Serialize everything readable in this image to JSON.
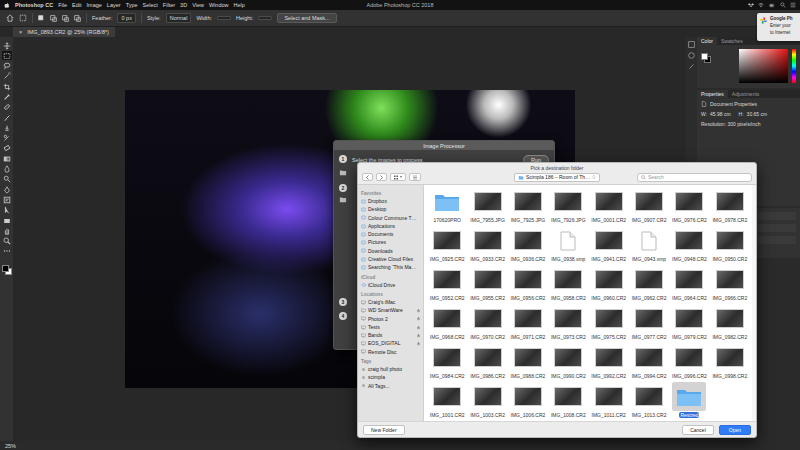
{
  "menu_bar": {
    "items": [
      "Photoshop CC",
      "File",
      "Edit",
      "Image",
      "Layer",
      "Type",
      "Select",
      "Filter",
      "3D",
      "View",
      "Window",
      "Help"
    ],
    "title": "Adobe Photoshop CC 2018"
  },
  "options_bar": {
    "feather_label": "Feather:",
    "feather_value": "0 px",
    "style_label": "Style:",
    "style_value": "Normal",
    "width_label": "Width:",
    "height_label": "Height:",
    "mask_button": "Select and Mask..."
  },
  "document_tab": {
    "label": "IMG_0893.CR2 @ 25% (RGB/8*)",
    "close": "×"
  },
  "tools": [
    {
      "selected": false
    },
    {
      "selected": true
    },
    {
      "selected": false
    },
    {
      "selected": false
    },
    {
      "selected": false
    },
    {
      "selected": false
    },
    {
      "selected": false
    },
    {
      "selected": false
    },
    {
      "selected": false
    },
    {
      "selected": false
    },
    {
      "selected": false
    },
    {
      "selected": false
    },
    {
      "selected": false
    },
    {
      "selected": false
    },
    {
      "selected": false
    },
    {
      "selected": false
    },
    {
      "selected": false
    },
    {
      "selected": false
    },
    {
      "selected": false
    },
    {
      "selected": false
    },
    {
      "selected": false
    }
  ],
  "notification": {
    "lines": [
      "Google Ph",
      "Enter your",
      "to Internet"
    ]
  },
  "color_panel": {
    "tabs": [
      {
        "label": "Color",
        "selected": true
      },
      {
        "label": "Swatches",
        "selected": false
      }
    ]
  },
  "properties_panel": {
    "tabs": [
      {
        "label": "Properties",
        "selected": true
      },
      {
        "label": "Adjustments",
        "selected": false
      }
    ],
    "heading": "Document Properties",
    "fields": [
      {
        "label": "W:",
        "value": "45.98 cm"
      },
      {
        "label": "H:",
        "value": "30.65 cm"
      }
    ],
    "resolution": "Resolution: 300 pixels/inch"
  },
  "status_bar": {
    "zoom": "25%"
  },
  "image_processor": {
    "title": "Image Processor",
    "instruction": "Select the images to process",
    "run": "Run",
    "steps": [
      "1",
      "2",
      "3",
      "4"
    ]
  },
  "file_dialog": {
    "prompt": "Pick a destination folder",
    "path": "Scimpla 186 – Room of Th…",
    "search": {
      "placeholder": "Search"
    },
    "sidebar": [
      {
        "title": "Favorites",
        "items": [
          {
            "label": "Dropbox",
            "ejectable": false
          },
          {
            "label": "Desktop",
            "ejectable": false
          },
          {
            "label": "Colour Commune T…",
            "ejectable": false
          },
          {
            "label": "Applications",
            "ejectable": false
          },
          {
            "label": "Documents",
            "ejectable": false
          },
          {
            "label": "Pictures",
            "ejectable": false
          },
          {
            "label": "Downloads",
            "ejectable": false
          },
          {
            "label": "Creative Cloud Files",
            "ejectable": false
          },
          {
            "label": "Searching “This Ma…",
            "ejectable": false
          }
        ]
      },
      {
        "title": "iCloud",
        "items": [
          {
            "label": "iCloud Drive",
            "ejectable": false
          }
        ]
      },
      {
        "title": "Locations",
        "items": [
          {
            "label": "Craig's iMac",
            "ejectable": false
          },
          {
            "label": "WD SmartWare",
            "ejectable": true
          },
          {
            "label": "Photos 2",
            "ejectable": true
          },
          {
            "label": "Tests",
            "ejectable": true
          },
          {
            "label": "Bands",
            "ejectable": true
          },
          {
            "label": "EOS_DIGITAL",
            "ejectable": true
          },
          {
            "label": "Remote Disc",
            "ejectable": false
          }
        ]
      },
      {
        "title": "Tags",
        "items": [
          {
            "label": "craig hull photo",
            "ejectable": false
          },
          {
            "label": "scimpla",
            "ejectable": false
          },
          {
            "label": "All Tags...",
            "ejectable": false
          }
        ]
      }
    ],
    "files": [
      {
        "name": "170620PRO",
        "kind": "folder",
        "selected": false
      },
      {
        "name": "IMG_7955.JPG",
        "kind": "photo",
        "selected": false
      },
      {
        "name": "IMG_7925.JPG",
        "kind": "photo",
        "selected": false
      },
      {
        "name": "IMG_7926.JPG",
        "kind": "photo",
        "selected": false
      },
      {
        "name": "IMG_0001.CR2",
        "kind": "photo",
        "selected": false
      },
      {
        "name": "IMG_0907.CR2",
        "kind": "photo",
        "selected": false
      },
      {
        "name": "IMG_0976.CR2",
        "kind": "photo",
        "selected": false
      },
      {
        "name": "IMG_0978.CR2",
        "kind": "photo",
        "selected": false
      },
      {
        "name": "IMG_0925.CR2",
        "kind": "photo",
        "selected": false
      },
      {
        "name": "IMG_0933.CR2",
        "kind": "photo",
        "selected": false
      },
      {
        "name": "IMG_0936.CR2",
        "kind": "photo",
        "selected": false
      },
      {
        "name": "IMG_0938.xmp",
        "kind": "document",
        "selected": false
      },
      {
        "name": "IMG_0941.CR2",
        "kind": "photo",
        "selected": false
      },
      {
        "name": "IMG_0943.xmp",
        "kind": "document",
        "selected": false
      },
      {
        "name": "IMG_0948.CR2",
        "kind": "photo",
        "selected": false
      },
      {
        "name": "IMG_0950.CR2",
        "kind": "photo",
        "selected": false
      },
      {
        "name": "IMG_0952.CR2",
        "kind": "photo",
        "selected": false
      },
      {
        "name": "IMG_0955.CR2",
        "kind": "photo",
        "selected": false
      },
      {
        "name": "IMG_0956.CR2",
        "kind": "photo",
        "selected": false
      },
      {
        "name": "IMG_0958.CR2",
        "kind": "photo",
        "selected": false
      },
      {
        "name": "IMG_0960.CR2",
        "kind": "photo",
        "selected": false
      },
      {
        "name": "IMG_0962.CR2",
        "kind": "photo",
        "selected": false
      },
      {
        "name": "IMG_0964.CR2",
        "kind": "photo",
        "selected": false
      },
      {
        "name": "IMG_0966.CR2",
        "kind": "photo",
        "selected": false
      },
      {
        "name": "IMG_0968.CR2",
        "kind": "photo",
        "selected": false
      },
      {
        "name": "IMG_0970.CR2",
        "kind": "photo",
        "selected": false
      },
      {
        "name": "IMG_0971.CR2",
        "kind": "photo",
        "selected": false
      },
      {
        "name": "IMG_0973.CR2",
        "kind": "photo",
        "selected": false
      },
      {
        "name": "IMG_0975.CR2",
        "kind": "photo",
        "selected": false
      },
      {
        "name": "IMG_0977.CR2",
        "kind": "photo",
        "selected": false
      },
      {
        "name": "IMG_0979.CR2",
        "kind": "photo",
        "selected": false
      },
      {
        "name": "IMG_0982.CR2",
        "kind": "photo",
        "selected": false
      },
      {
        "name": "IMG_0984.CR2",
        "kind": "photo",
        "selected": false
      },
      {
        "name": "IMG_0986.CR2",
        "kind": "photo",
        "selected": false
      },
      {
        "name": "IMG_0988.CR2",
        "kind": "photo",
        "selected": false
      },
      {
        "name": "IMG_0990.CR2",
        "kind": "photo",
        "selected": false
      },
      {
        "name": "IMG_0992.CR2",
        "kind": "photo",
        "selected": false
      },
      {
        "name": "IMG_0994.CR2",
        "kind": "photo",
        "selected": false
      },
      {
        "name": "IMG_0996.CR2",
        "kind": "photo",
        "selected": false
      },
      {
        "name": "IMG_0998.CR2",
        "kind": "photo",
        "selected": false
      },
      {
        "name": "IMG_1001.CR2",
        "kind": "photo",
        "selected": false
      },
      {
        "name": "IMG_1003.CR2",
        "kind": "photo",
        "selected": false
      },
      {
        "name": "IMG_1006.CR2",
        "kind": "photo",
        "selected": false
      },
      {
        "name": "IMG_1008.CR2",
        "kind": "photo",
        "selected": false
      },
      {
        "name": "IMG_1011.CR2",
        "kind": "photo",
        "selected": false
      },
      {
        "name": "IMG_1013.CR2",
        "kind": "photo",
        "selected": false
      },
      {
        "name": "Resized",
        "kind": "folder",
        "selected": true
      }
    ],
    "buttons": {
      "new_folder": "New Folder",
      "cancel": "Cancel",
      "open": "Open"
    }
  }
}
